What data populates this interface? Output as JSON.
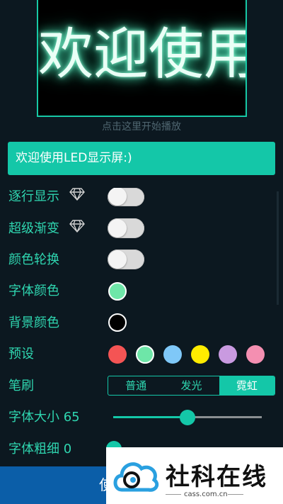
{
  "preview": {
    "text": "欢迎使用L"
  },
  "hint": "点击这里开始播放",
  "input": {
    "value": "欢迎使用LED显示屏:)"
  },
  "settings": {
    "line_by_line": "逐行显示",
    "gradient": "超级渐变",
    "color_cycle": "颜色轮换",
    "font_color": "字体颜色",
    "bg_color": "背景颜色",
    "presets": "预设",
    "brush": "笔刷",
    "font_size": "字体大小 65",
    "font_weight": "字体粗细 0"
  },
  "colors": {
    "accent": "#14c7a8",
    "font_color": "#6ee6a8",
    "bg_color": "#000000",
    "presets": [
      "#f45454",
      "#6ee6a8",
      "#7fc8f8",
      "#ffec00",
      "#c99ae0",
      "#f48fb1"
    ]
  },
  "brush": {
    "options": [
      "普通",
      "发光",
      "霓虹"
    ],
    "selected": "霓虹"
  },
  "font_size_value": 65,
  "font_size_fraction": 0.5,
  "bottom_button": "使",
  "watermark": {
    "title": "社科在线",
    "url": "cass.com.cn"
  }
}
